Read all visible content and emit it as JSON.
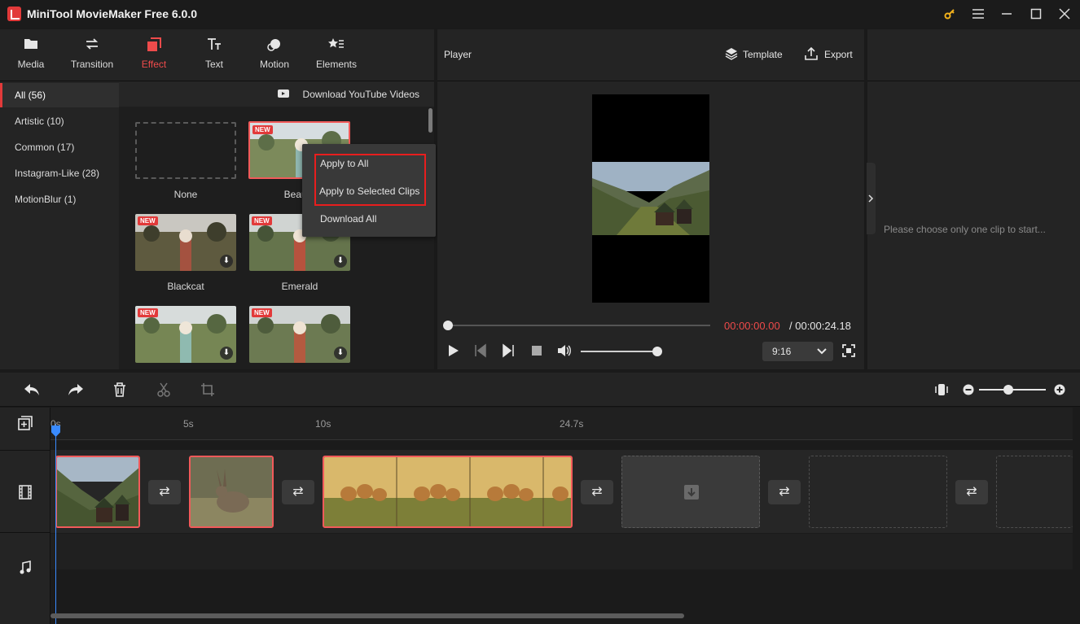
{
  "window": {
    "title": "MiniTool MovieMaker Free 6.0.0"
  },
  "toolbar": {
    "tabs": [
      {
        "label": "Media"
      },
      {
        "label": "Transition"
      },
      {
        "label": "Effect"
      },
      {
        "label": "Text"
      },
      {
        "label": "Motion"
      },
      {
        "label": "Elements"
      }
    ],
    "active": "Effect"
  },
  "categories": [
    {
      "label": "All (56)"
    },
    {
      "label": "Artistic (10)"
    },
    {
      "label": "Common (17)"
    },
    {
      "label": "Instagram-Like (28)"
    },
    {
      "label": "MotionBlur (1)"
    }
  ],
  "download_youtube": "Download YouTube Videos",
  "effects": [
    {
      "name": "None",
      "new": false
    },
    {
      "name": "Beautif",
      "new": true,
      "badge": "NEW"
    },
    {
      "name": "Blackcat",
      "new": true,
      "badge": "NEW"
    },
    {
      "name": "Emerald",
      "new": true,
      "badge": "NEW"
    },
    {
      "name": "",
      "new": true,
      "badge": "NEW"
    },
    {
      "name": "",
      "new": true,
      "badge": "NEW"
    }
  ],
  "context_menu": {
    "items": [
      {
        "label": "Apply to All"
      },
      {
        "label": "Apply to Selected Clips"
      },
      {
        "label": "Download All"
      }
    ]
  },
  "player": {
    "title": "Player",
    "template_label": "Template",
    "export_label": "Export",
    "time_current": "00:00:00.00",
    "time_separator": " / ",
    "time_total": "00:00:24.18",
    "progress": 0,
    "volume": 1.0,
    "aspect_ratio": "9:16"
  },
  "properties": {
    "hint": "Please choose only one clip to start..."
  },
  "timeline": {
    "ticks": [
      "0s",
      "5s",
      "10s",
      "24.7s"
    ],
    "zoom": 0.45
  },
  "colors": {
    "accent": "#e23a3a",
    "playhead": "#3a8bff",
    "highlight": "#e81e1e"
  }
}
